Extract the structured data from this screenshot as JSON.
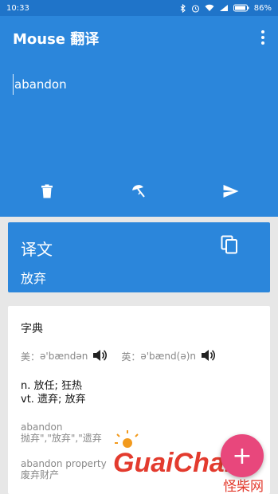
{
  "status": {
    "time": "10:33",
    "battery": "86%"
  },
  "app": {
    "title": "Mouse 翻译"
  },
  "input": {
    "text": "abandon"
  },
  "translation": {
    "label": "译文",
    "result": "放弃"
  },
  "dictionary": {
    "title": "字典",
    "us_label": "美：",
    "us_phonetic": "ə'bændən",
    "uk_label": "英：",
    "uk_phonetic": "ə'bænd(ə)n",
    "definitions": [
      "n. 放任; 狂热",
      "vt. 遗弃; 放弃"
    ],
    "entries": [
      {
        "word": "abandon",
        "meaning": "抛弃\",\"放弃\",\"遗弃"
      },
      {
        "word": "abandon property",
        "meaning": "废弃财产"
      }
    ]
  },
  "fab": {
    "symbol": "+"
  },
  "watermark": {
    "text": "GuaiChai",
    "subtext": "怪柴网"
  },
  "colors": {
    "primary": "#2b86db",
    "status_bar": "#1f74c9",
    "fab": "#e8477c",
    "watermark": "#e33b2e"
  }
}
